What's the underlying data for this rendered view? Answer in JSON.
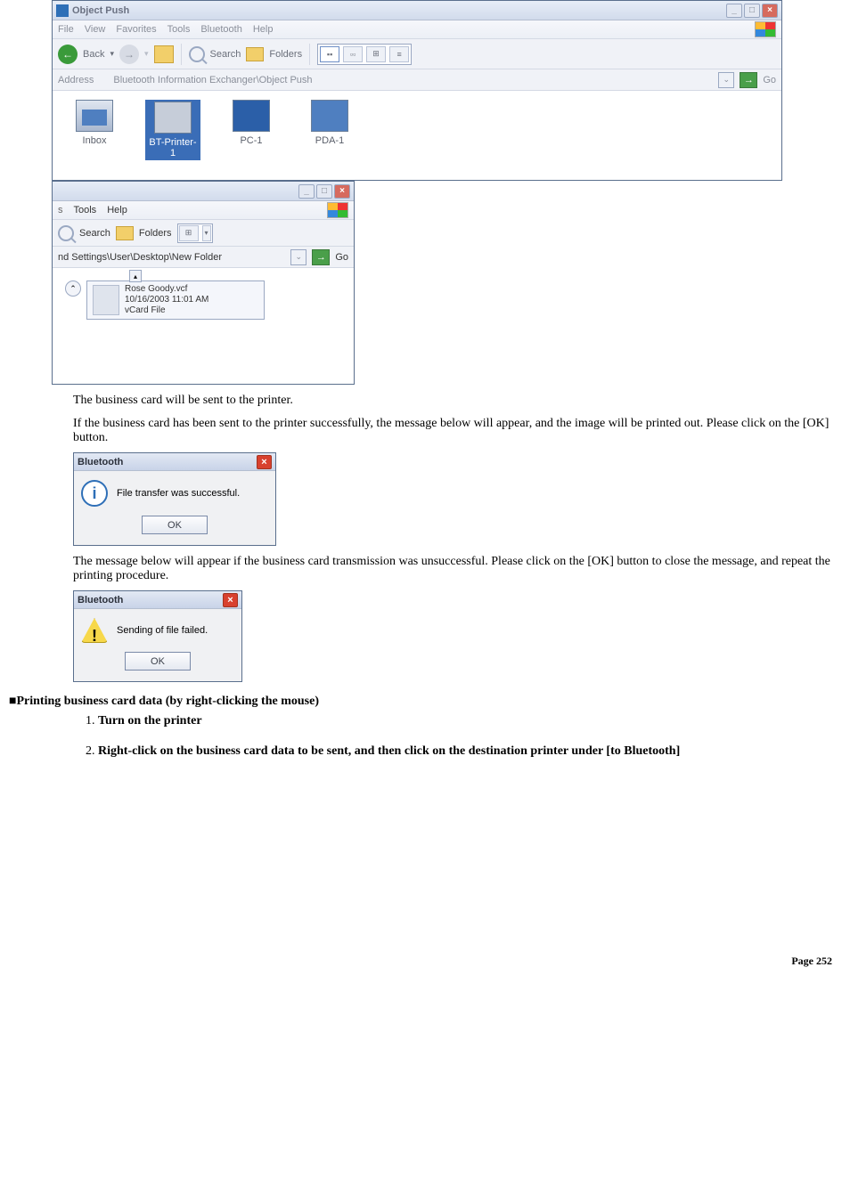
{
  "win1": {
    "title": "Object Push",
    "menu": {
      "file": "File",
      "view": "View",
      "fav": "Favorites",
      "tools": "Tools",
      "bt": "Bluetooth",
      "help": "Help"
    },
    "toolbar": {
      "back": "Back",
      "search": "Search",
      "folders": "Folders"
    },
    "address_label": "Address",
    "address_path": "Bluetooth Information Exchanger\\Object Push",
    "go": "Go",
    "items": {
      "inbox": "Inbox",
      "printer": "BT-Printer-1",
      "pc": "PC-1",
      "pda": "PDA-1"
    }
  },
  "win2": {
    "menu": {
      "tools": "Tools",
      "help": "Help"
    },
    "toolbar": {
      "search": "Search",
      "folders": "Folders"
    },
    "address_path": "nd Settings\\User\\Desktop\\New Folder",
    "go": "Go",
    "file": {
      "name": "Rose Goody.vcf",
      "date": "10/16/2003 11:01 AM",
      "type": "vCard File"
    }
  },
  "para1": "The business card will be sent to the printer.",
  "para2": "If the business card has been sent to the printer successfully, the message below will appear, and the image will be printed out. Please click on the [OK] button.",
  "dlg_success": {
    "title": "Bluetooth",
    "msg": "File transfer was successful.",
    "ok": "OK"
  },
  "para3": "The message below will appear if the business card transmission was unsuccessful. Please click on the [OK] button to close the message, and repeat the printing procedure.",
  "dlg_fail": {
    "title": "Bluetooth",
    "msg": "Sending of file failed.",
    "ok": "OK"
  },
  "section_marker": "■",
  "section_title": "Printing business card data (by right-clicking the mouse)",
  "steps": {
    "s1": "Turn on the printer",
    "s2": "Right-click on the business card data to be sent, and then click on the destination printer under [to Bluetooth]"
  },
  "footer": "Page 252"
}
